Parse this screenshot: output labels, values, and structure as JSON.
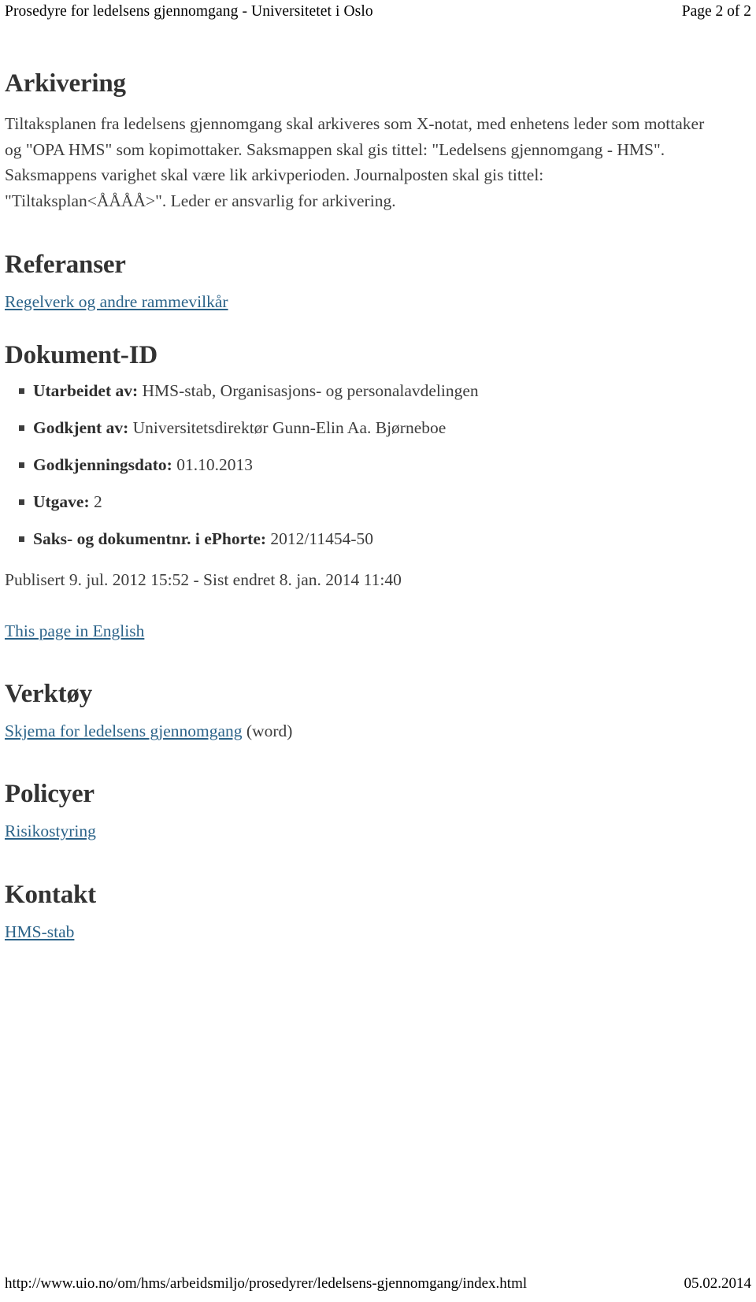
{
  "header": {
    "title": "Prosedyre for ledelsens gjennomgang - Universitetet i Oslo",
    "page_indicator": "Page 2 of 2"
  },
  "sections": {
    "arkivering": {
      "heading": "Arkivering",
      "paragraph": "Tiltaksplanen fra ledelsens gjennomgang skal arkiveres som X-notat, med enhetens leder som mottaker og \"OPA HMS\" som kopimottaker. Saksmappen skal gis tittel: \"Ledelsens gjennomgang - HMS\". Saksmappens varighet skal være lik arkivperioden. Journalposten skal gis tittel: \"Tiltaksplan<ÅÅÅÅ>\". Leder er ansvarlig for arkivering."
    },
    "referanser": {
      "heading": "Referanser",
      "link": "Regelverk og andre rammevilkår"
    },
    "dokument_id": {
      "heading": "Dokument-ID",
      "items": [
        {
          "label": "Utarbeidet av:",
          "value": "HMS-stab, Organisasjons- og personalavdelingen"
        },
        {
          "label": "Godkjent av:",
          "value": "Universitetsdirektør Gunn-Elin Aa. Bjørneboe"
        },
        {
          "label": "Godkjenningsdato:",
          "value": "01.10.2013"
        },
        {
          "label": "Utgave:",
          "value": "2"
        },
        {
          "label": "Saks- og dokumentnr. i ePhorte:",
          "value": "2012/11454-50"
        }
      ],
      "published_line": "Publisert 9. jul. 2012 15:52 - Sist endret 8. jan. 2014 11:40",
      "english_link": "This page in English"
    },
    "verktoy": {
      "heading": "Verktøy",
      "link": "Skjema for ledelsens gjennomgang",
      "suffix": " (word)"
    },
    "policyer": {
      "heading": "Policyer",
      "link": "Risikostyring"
    },
    "kontakt": {
      "heading": "Kontakt",
      "link": "HMS-stab"
    }
  },
  "footer": {
    "url": "http://www.uio.no/om/hms/arbeidsmiljo/prosedyrer/ledelsens-gjennomgang/index.html",
    "date": "05.02.2014"
  },
  "colors": {
    "link": "#2b6389",
    "heading": "#333333",
    "body": "#3d3d3d",
    "header_footer": "#000000",
    "background": "#ffffff"
  }
}
